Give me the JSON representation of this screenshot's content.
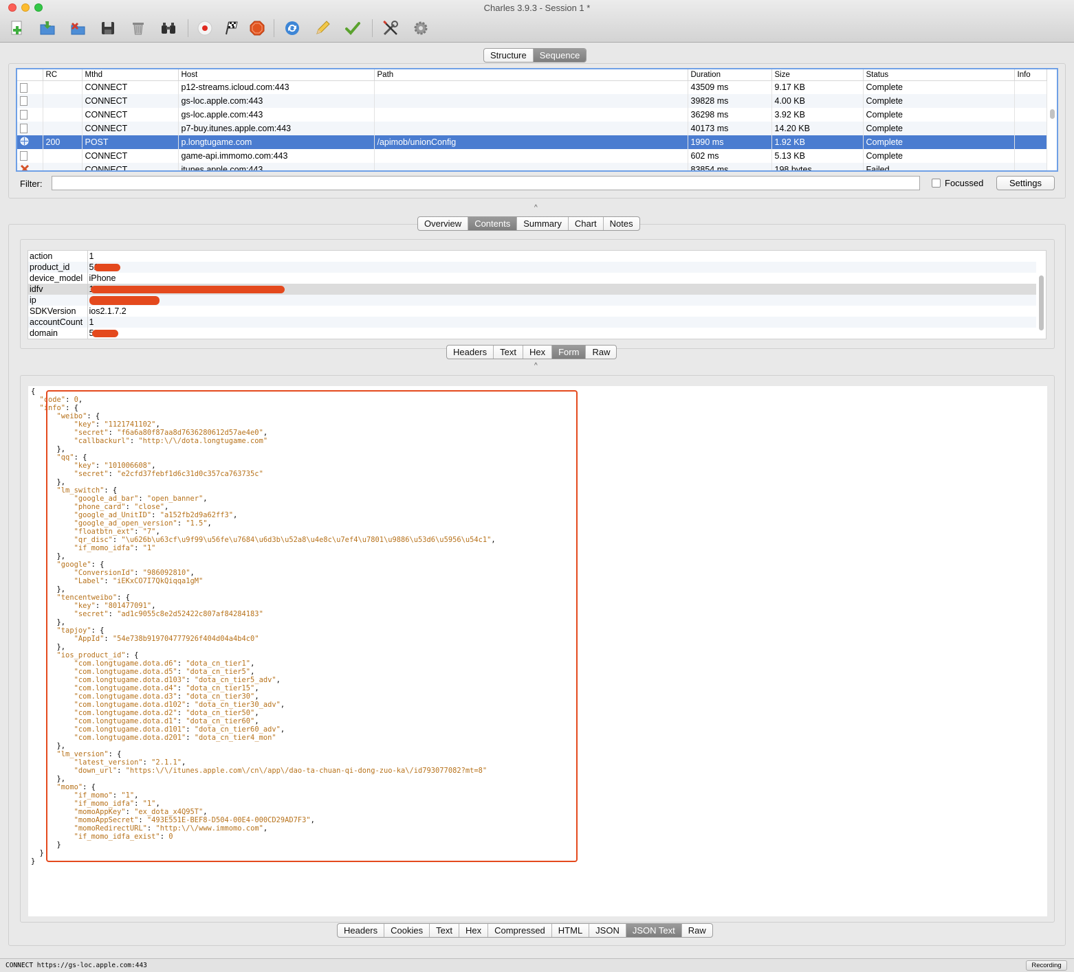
{
  "window": {
    "title": "Charles 3.9.3 - Session 1 *"
  },
  "toolbar": {
    "tools": [
      {
        "name": "new-session-icon",
        "label": "New Session"
      },
      {
        "name": "open-session-icon",
        "label": "Open Session"
      },
      {
        "name": "close-session-icon",
        "label": "Close Session"
      },
      {
        "name": "save-icon",
        "label": "Save"
      },
      {
        "name": "clear-icon",
        "label": "Clear"
      },
      {
        "name": "find-icon",
        "label": "Find"
      },
      {
        "name": "record-icon",
        "label": "Record"
      },
      {
        "name": "throttle-icon",
        "label": "Throttle"
      },
      {
        "name": "breakpoints-icon",
        "label": "Breakpoints"
      },
      {
        "name": "repeat-icon",
        "label": "Repeat"
      },
      {
        "name": "edit-icon",
        "label": "Edit"
      },
      {
        "name": "validate-icon",
        "label": "Validate"
      },
      {
        "name": "tools-icon",
        "label": "Tools"
      },
      {
        "name": "settings-gear-icon",
        "label": "Settings"
      }
    ]
  },
  "view_tabs": [
    "Structure",
    "Sequence"
  ],
  "view_active": "Sequence",
  "sequence": {
    "columns": [
      "",
      "RC",
      "Mthd",
      "Host",
      "Path",
      "Duration",
      "Size",
      "Status",
      "Info"
    ],
    "rows": [
      {
        "rc": "",
        "method": "CONNECT",
        "host": "p12-streams.icloud.com:443",
        "path": "",
        "duration": "43509 ms",
        "size": "9.17 KB",
        "status": "Complete",
        "info": ""
      },
      {
        "rc": "",
        "method": "CONNECT",
        "host": "gs-loc.apple.com:443",
        "path": "",
        "duration": "39828 ms",
        "size": "4.00 KB",
        "status": "Complete",
        "info": ""
      },
      {
        "rc": "",
        "method": "CONNECT",
        "host": "gs-loc.apple.com:443",
        "path": "",
        "duration": "36298 ms",
        "size": "3.92 KB",
        "status": "Complete",
        "info": ""
      },
      {
        "rc": "",
        "method": "CONNECT",
        "host": "p7-buy.itunes.apple.com:443",
        "path": "",
        "duration": "40173 ms",
        "size": "14.20 KB",
        "status": "Complete",
        "info": ""
      },
      {
        "rc": "200",
        "method": "POST",
        "host": "p.longtugame.com",
        "path": "/apimob/unionConfig",
        "duration": "1990 ms",
        "size": "1.92 KB",
        "status": "Complete",
        "info": ""
      },
      {
        "rc": "",
        "method": "CONNECT",
        "host": "game-api.immomo.com:443",
        "path": "",
        "duration": "602 ms",
        "size": "5.13 KB",
        "status": "Complete",
        "info": ""
      },
      {
        "rc": "",
        "method": "CONNECT",
        "host": "itunes.apple.com:443",
        "path": "",
        "duration": "83854 ms",
        "size": "198 bytes",
        "status": "Failed",
        "info": ""
      }
    ]
  },
  "filter": {
    "label": "Filter:",
    "value": "",
    "focussed_label": "Focussed",
    "settings_label": "Settings"
  },
  "detail_tabs": [
    "Overview",
    "Contents",
    "Summary",
    "Chart",
    "Notes"
  ],
  "detail_active": "Contents",
  "request_form": [
    {
      "key": "action",
      "value": "1"
    },
    {
      "key": "product_id",
      "value": "51"
    },
    {
      "key": "device_model",
      "value": "iPhone"
    },
    {
      "key": "idfv",
      "value": "1"
    },
    {
      "key": "ip",
      "value": ""
    },
    {
      "key": "SDKVersion",
      "value": "ios2.1.7.2"
    },
    {
      "key": "accountCount",
      "value": "1"
    },
    {
      "key": "domain",
      "value": "5"
    }
  ],
  "request_tabs": [
    "Headers",
    "Text",
    "Hex",
    "Form",
    "Raw"
  ],
  "request_active": "Form",
  "json_lines": [
    "{",
    "  \"code\": 0,",
    "  \"info\": {",
    "      \"weibo\": {",
    "          \"key\": \"1121741102\",",
    "          \"secret\": \"f6a6a80f87aa8d7636280612d57ae4e0\",",
    "          \"callbackurl\": \"http:\\/\\/dota.longtugame.com\"",
    "      },",
    "      \"qq\": {",
    "          \"key\": \"101006608\",",
    "          \"secret\": \"e2cfd37febf1d6c31d0c357ca763735c\"",
    "      },",
    "      \"lm_switch\": {",
    "          \"google_ad_bar\": \"open_banner\",",
    "          \"phone_card\": \"close\",",
    "          \"google_ad_UnitID\": \"a152fb2d9a62ff3\",",
    "          \"google_ad_open_version\": \"1.5\",",
    "          \"floatbtn_ext\": \"7\",",
    "          \"qr_disc\": \"\\u626b\\u63cf\\u9f99\\u56fe\\u7684\\u6d3b\\u52a8\\u4e8c\\u7ef4\\u7801\\u9886\\u53d6\\u5956\\u54c1\",",
    "          \"if_momo_idfa\": \"1\"",
    "      },",
    "      \"google\": {",
    "          \"ConversionId\": \"986092810\",",
    "          \"Label\": \"iEKxCO7I7QkQiqqa1gM\"",
    "      },",
    "      \"tencentweibo\": {",
    "          \"key\": \"801477091\",",
    "          \"secret\": \"ad1c9055c8e2d52422c807af84284183\"",
    "      },",
    "      \"tapjoy\": {",
    "          \"AppId\": \"54e738b919704777926f404d04a4b4c0\"",
    "      },",
    "      \"ios_product_id\": {",
    "          \"com.longtugame.dota.d6\": \"dota_cn_tier1\",",
    "          \"com.longtugame.dota.d5\": \"dota_cn_tier5\",",
    "          \"com.longtugame.dota.d103\": \"dota_cn_tier5_adv\",",
    "          \"com.longtugame.dota.d4\": \"dota_cn_tier15\",",
    "          \"com.longtugame.dota.d3\": \"dota_cn_tier30\",",
    "          \"com.longtugame.dota.d102\": \"dota_cn_tier30_adv\",",
    "          \"com.longtugame.dota.d2\": \"dota_cn_tier50\",",
    "          \"com.longtugame.dota.d1\": \"dota_cn_tier60\",",
    "          \"com.longtugame.dota.d101\": \"dota_cn_tier60_adv\",",
    "          \"com.longtugame.dota.d201\": \"dota_cn_tier4_mon\"",
    "      },",
    "      \"lm_version\": {",
    "          \"latest_version\": \"2.1.1\",",
    "          \"down_url\": \"https:\\/\\/itunes.apple.com\\/cn\\/app\\/dao-ta-chuan-qi-dong-zuo-ka\\/id793077082?mt=8\"",
    "      },",
    "      \"momo\": {",
    "          \"if_momo\": \"1\",",
    "          \"if_momo_idfa\": \"1\",",
    "          \"momoAppKey\": \"ex_dota_x4Q95T\",",
    "          \"momoAppSecret\": \"493E551E-BEF8-D504-00E4-000CD29AD7F3\",",
    "          \"momoRedirectURL\": \"http:\\/\\/www.immomo.com\",",
    "          \"if_momo_idfa_exist\": 0",
    "      }",
    "  }",
    "}"
  ],
  "response_tabs": [
    "Headers",
    "Cookies",
    "Text",
    "Hex",
    "Compressed",
    "HTML",
    "JSON",
    "JSON Text",
    "Raw"
  ],
  "response_active": "JSON Text",
  "statusbar": {
    "text": "CONNECT https://gs-loc.apple.com:443",
    "recording": "Recording"
  },
  "colors": {
    "selection": "#4a7cd0",
    "json_key": "#b7721b",
    "annotation": "#e4491d",
    "focus_ring": "#6fa0e6"
  }
}
